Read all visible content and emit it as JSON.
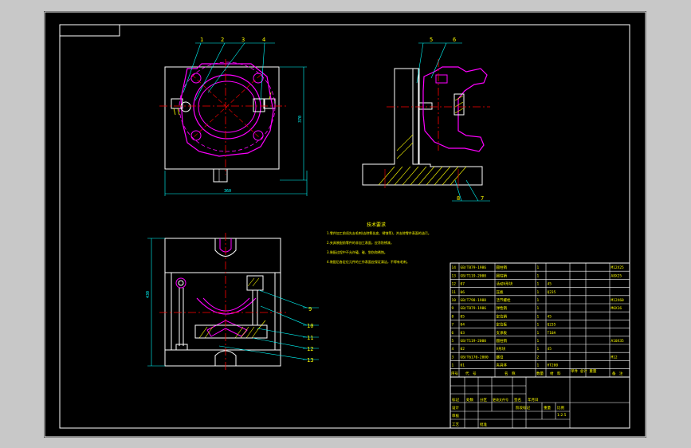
{
  "colors": {
    "background": "#000000",
    "frame": "#ffffff",
    "outline": "#ffffff",
    "part": "#ff00ff",
    "centerline": "#ff0000",
    "dimension": "#00ffff",
    "hatch": "#ffff00",
    "text": "#ffff00"
  },
  "balloons": {
    "top_view": [
      "1",
      "2",
      "3",
      "4"
    ],
    "side_view": [
      "5",
      "6",
      "7",
      "8"
    ],
    "front_view": [
      "9",
      "10",
      "11",
      "12",
      "13"
    ]
  },
  "dimensions": {
    "top_width": "360",
    "top_height": "370",
    "front_height": "430"
  },
  "tech_requirements": {
    "title": "技术要求",
    "lines": [
      "1.零件加工前须先去毛刺(去除氧化皮、锈蚀等)，并去除零件表面的油污。",
      "2.夹具装配前零件的非加工表面，应涂防锈漆。",
      "3.装配过程中不允许磕、碰、划伤和锈蚀。",
      "4.装配后各定位元件的工作表面应保证清洁，不得有毛刺。"
    ]
  },
  "bom": {
    "rows": [
      {
        "no": "14",
        "code": "GB/T879-1986",
        "name": "圆柱销",
        "qty": "1",
        "material": "",
        "note": "M12X25"
      },
      {
        "no": "13",
        "code": "GB/T119-2000",
        "name": "圆柱销",
        "qty": "1",
        "material": "",
        "note": "A8X25"
      },
      {
        "no": "12",
        "code": "07",
        "name": "活动V形块",
        "qty": "1",
        "material": "45",
        "note": ""
      },
      {
        "no": "11",
        "code": "06",
        "name": "压板",
        "qty": "1",
        "material": "Q235",
        "note": ""
      },
      {
        "no": "10",
        "code": "GB/T798-1988",
        "name": "活节螺栓",
        "qty": "1",
        "material": "",
        "note": "M12X60"
      },
      {
        "no": "9",
        "code": "GB/T879-1986",
        "name": "弹性销",
        "qty": "1",
        "material": "",
        "note": "M6X16"
      },
      {
        "no": "8",
        "code": "05",
        "name": "定位销",
        "qty": "1",
        "material": "45",
        "note": ""
      },
      {
        "no": "7",
        "code": "04",
        "name": "定位板",
        "qty": "1",
        "material": "Q235",
        "note": ""
      },
      {
        "no": "6",
        "code": "03",
        "name": "支承板",
        "qty": "1",
        "material": "T10A",
        "note": ""
      },
      {
        "no": "5",
        "code": "GB/T119-2000",
        "name": "圆柱销",
        "qty": "1",
        "material": "",
        "note": "A10X35"
      },
      {
        "no": "4",
        "code": "02",
        "name": "V形块",
        "qty": "1",
        "material": "45",
        "note": ""
      },
      {
        "no": "3",
        "code": "GB/T6170-2000",
        "name": "螺母",
        "qty": "2",
        "material": "",
        "note": "M12"
      },
      {
        "no": "1",
        "code": "01",
        "name": "夹具体",
        "qty": "1",
        "material": "HT200",
        "note": ""
      }
    ],
    "header": {
      "no": "序号",
      "code": "代　号",
      "name": "名　称",
      "qty": "数量",
      "material": "材　料",
      "weight": "单件 总计 重量",
      "note": "备　注"
    }
  },
  "title_block": {
    "labels": [
      "标记",
      "处数",
      "分区",
      "更改文件号",
      "签名",
      "年月日"
    ],
    "designer": "设计",
    "stage": "阶段标记",
    "weight_label": "重量",
    "scale_label": "比例",
    "scale": "1:2.5",
    "reviewer": "审核",
    "craft": "工艺",
    "approve": "批准"
  }
}
